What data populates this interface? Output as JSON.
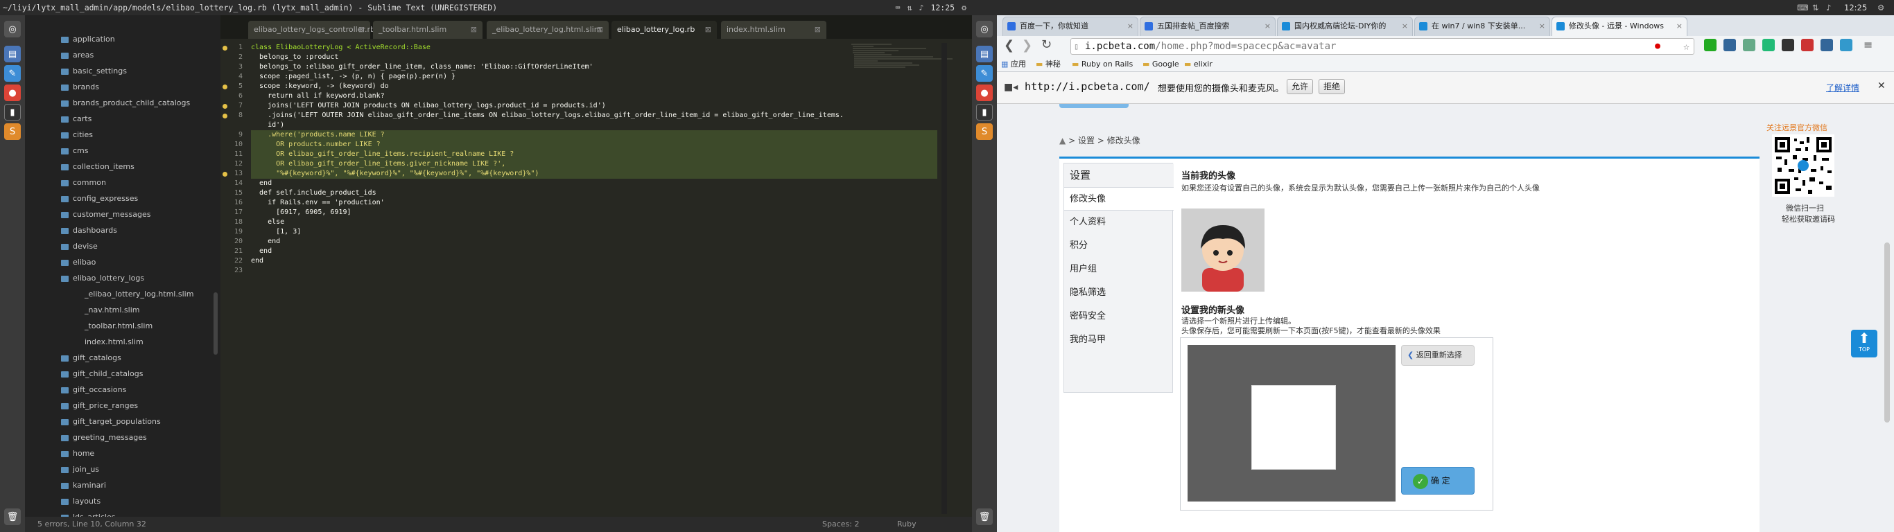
{
  "sublime": {
    "title": "~/liyi/lytx_mall_admin/app/models/elibao_lottery_log.rb (lytx_mall_admin) - Sublime Text (UNREGISTERED)",
    "clock": "12:25",
    "tabs": [
      "elibao_lottery_logs_controller.rb",
      "_toolbar.html.slim",
      "_elibao_lottery_log.html.slim",
      "elibao_lottery_log.rb",
      "index.html.slim"
    ],
    "tree": [
      {
        "label": "application",
        "indent": 1
      },
      {
        "label": "areas",
        "indent": 1
      },
      {
        "label": "basic_settings",
        "indent": 1
      },
      {
        "label": "brands",
        "indent": 1
      },
      {
        "label": "brands_product_child_catalogs",
        "indent": 1
      },
      {
        "label": "carts",
        "indent": 1
      },
      {
        "label": "cities",
        "indent": 1
      },
      {
        "label": "cms",
        "indent": 1
      },
      {
        "label": "collection_items",
        "indent": 1
      },
      {
        "label": "common",
        "indent": 1
      },
      {
        "label": "config_expresses",
        "indent": 1
      },
      {
        "label": "customer_messages",
        "indent": 1
      },
      {
        "label": "dashboards",
        "indent": 1
      },
      {
        "label": "devise",
        "indent": 1
      },
      {
        "label": "elibao",
        "indent": 1
      },
      {
        "label": "elibao_lottery_logs",
        "indent": 1
      },
      {
        "label": "_elibao_lottery_log.html.slim",
        "indent": 2
      },
      {
        "label": "_nav.html.slim",
        "indent": 2
      },
      {
        "label": "_toolbar.html.slim",
        "indent": 2
      },
      {
        "label": "index.html.slim",
        "indent": 2
      },
      {
        "label": "gift_catalogs",
        "indent": 1
      },
      {
        "label": "gift_child_catalogs",
        "indent": 1
      },
      {
        "label": "gift_occasions",
        "indent": 1
      },
      {
        "label": "gift_price_ranges",
        "indent": 1
      },
      {
        "label": "gift_target_populations",
        "indent": 1
      },
      {
        "label": "greeting_messages",
        "indent": 1
      },
      {
        "label": "home",
        "indent": 1
      },
      {
        "label": "join_us",
        "indent": 1
      },
      {
        "label": "kaminari",
        "indent": 1
      },
      {
        "label": "layouts",
        "indent": 1
      },
      {
        "label": "lds_articles",
        "indent": 1
      }
    ],
    "status_left": "5 errors, Line 10, Column 32",
    "status_spaces": "Spaces: 2",
    "status_syntax": "Ruby",
    "code": [
      "class ElibaoLotteryLog < ActiveRecord::Base",
      "  belongs_to :product",
      "  belongs_to :elibao_gift_order_line_item, class_name: 'Elibao::GiftOrderLineItem'",
      "  scope :paged_list, -> (p, n) { page(p).per(n) }",
      "  scope :keyword, -> (keyword) do",
      "    return all if keyword.blank?",
      "    joins('LEFT OUTER JOIN products ON elibao_lottery_logs.product_id = products.id')",
      "    .joins('LEFT OUTER JOIN elibao_gift_order_line_items ON elibao_lottery_logs.elibao_gift_order_line_item_id = elibao_gift_order_line_items.",
      "    id')",
      "    .where('products.name LIKE ?",
      "      OR products.number LIKE ?",
      "      OR elibao_gift_order_line_items.recipient_realname LIKE ?",
      "      OR elibao_gift_order_line_items.giver_nickname LIKE ?',",
      "      \"%#{keyword}%\", \"%#{keyword}%\", \"%#{keyword}%\", \"%#{keyword}%\")",
      "  end",
      "  def self.include_product_ids",
      "    if Rails.env == 'production'",
      "      [6917, 6905, 6919]",
      "    else",
      "      [1, 3]",
      "    end",
      "  end",
      "end",
      ""
    ],
    "line_numbers": [
      "1",
      "2",
      "3",
      "4",
      "5",
      "6",
      "7",
      "8",
      "",
      "9",
      "10",
      "11",
      "12",
      "13",
      "14",
      "15",
      "16",
      "17",
      "18",
      "19",
      "20",
      "21",
      "22",
      "23"
    ]
  },
  "chrome": {
    "clock": "12:25",
    "tabs": [
      "百度一下，你就知道",
      "五国排查帖_百度搜索",
      "国内权威高端论坛-DIY你的",
      "在 win7 / win8 下安装单...",
      "修改头像 - 远景 - Windows"
    ],
    "url_host": "i.pcbeta.com",
    "url_path": "/home.php?mod=spacecp&ac=avatar",
    "bookmarks": [
      "应用",
      "神秘",
      "Ruby on Rails",
      "Google",
      "elixir"
    ],
    "infobar_url": "http://i.pcbeta.com/",
    "infobar_msg": "想要使用您的摄像头和麦克风。",
    "allow": "允许",
    "deny": "拒绝",
    "learn_more": "了解详情"
  },
  "site": {
    "breadcrumb_home": "首页",
    "breadcrumb_settings": "设置",
    "breadcrumb_current": "修改头像",
    "sep": ">",
    "nav_title": "设置",
    "nav_items": [
      "修改头像",
      "个人资料",
      "积分",
      "用户组",
      "隐私筛选",
      "密码安全",
      "我的马甲"
    ],
    "current_avatar_title": "当前我的头像",
    "current_avatar_desc": "如果您还没有设置自己的头像，系统会显示为默认头像，您需要自己上传一张新照片来作为自己的个人头像",
    "new_avatar_title": "设置我的新头像",
    "new_avatar_desc1": "请选择一个新照片进行上传编辑。",
    "new_avatar_desc2": "头像保存后，您可能需要刷新一下本页面(按F5键)，才能查看最新的头像效果",
    "reselect": "返回重新选择",
    "confirm": "确 定",
    "follow": "关注远景官方微信",
    "qr_line1": "微信扫一扫",
    "qr_line2": "轻松获取邀请码",
    "top": "TOP"
  }
}
